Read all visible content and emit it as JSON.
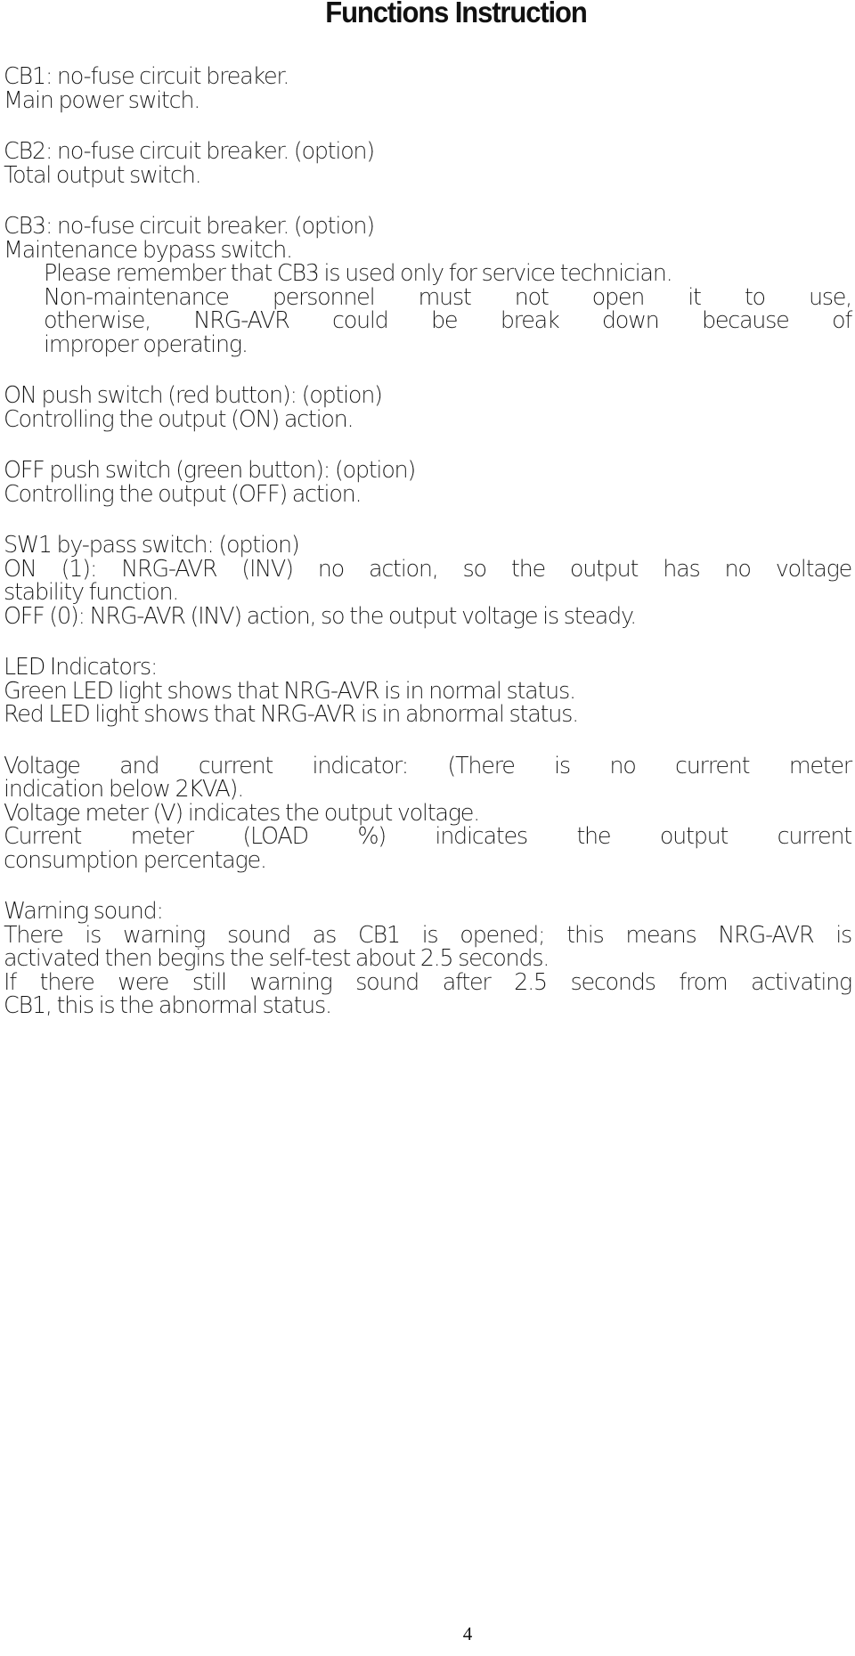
{
  "document": {
    "title": "Functions Instruction",
    "page_number": "4",
    "sections": {
      "cb1": {
        "heading": "CB1: no-fuse circuit breaker.",
        "line1": "Main power switch."
      },
      "cb2": {
        "heading": "CB2: no-fuse circuit breaker. (option)",
        "line1": "Total output switch."
      },
      "cb3": {
        "heading": "CB3: no-fuse circuit breaker. (option)",
        "line1": "Maintenance bypass switch.",
        "note1": "Please remember that CB3 is used only for service technician.",
        "note2": "Non-maintenance personnel must not open it to use,",
        "note3": "otherwise, NRG-AVR could be break down because of",
        "note4": "improper operating."
      },
      "on_switch": {
        "heading": "ON push switch (red button): (option)",
        "line1": "Controlling the output (ON) action."
      },
      "off_switch": {
        "heading": "OFF push switch (green button): (option)",
        "line1": "Controlling the output (OFF) action."
      },
      "sw1": {
        "heading": "SW1 by-pass switch: (option)",
        "line1": "ON (1): NRG-AVR (INV) no action, so the output has no voltage",
        "line2": "stability function.",
        "line3": "OFF (0): NRG-AVR (INV) action, so the output voltage is steady."
      },
      "led": {
        "heading": "LED Indicators:",
        "line1": "Green LED light shows that NRG-AVR is in normal status.",
        "line2": "Red LED light shows that NRG-AVR is in abnormal status."
      },
      "meters": {
        "heading": "Voltage and current indicator: (There is no current meter",
        "line1": "indication below 2KVA).",
        "line2": "Voltage meter (V) indicates the output voltage.",
        "line3": "Current meter (LOAD %) indicates the output current",
        "line4": "consumption percentage."
      },
      "warning": {
        "heading": "Warning sound:",
        "line1": "There is warning sound as CB1 is opened; this means NRG-AVR is",
        "line2": "activated then begins the self-test about 2.5 seconds.",
        "line3": "If there were still warning sound after 2.5 seconds from activating",
        "line4": "CB1, this is the abnormal status."
      }
    }
  }
}
